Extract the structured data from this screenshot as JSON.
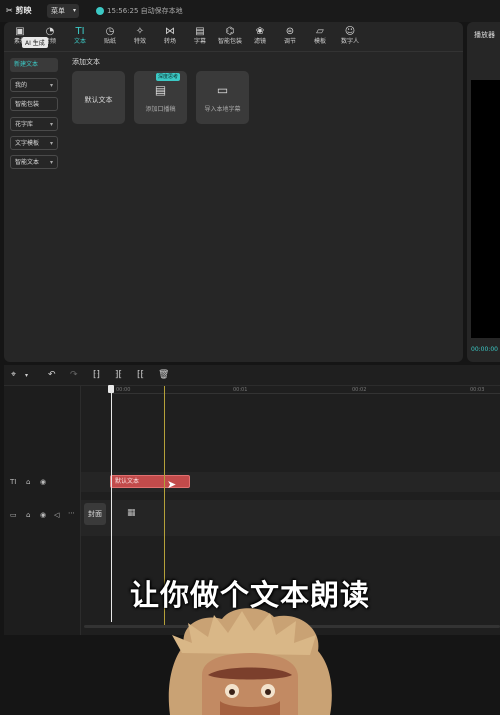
{
  "app": {
    "name": "剪映",
    "menu": "菜单",
    "save_status": "15:56:25 自动保存本地"
  },
  "toolbar": {
    "items": [
      {
        "label": "素材",
        "icon": "media-icon"
      },
      {
        "label": "音频",
        "icon": "audio-icon"
      },
      {
        "label": "文本",
        "icon": "text-icon",
        "active": true
      },
      {
        "label": "贴纸",
        "icon": "sticker-icon"
      },
      {
        "label": "特效",
        "icon": "effects-icon"
      },
      {
        "label": "转场",
        "icon": "transition-icon"
      },
      {
        "label": "字幕",
        "icon": "subtitle-icon"
      },
      {
        "label": "智能包装",
        "icon": "smart-package-icon"
      },
      {
        "label": "滤镜",
        "icon": "filter-icon"
      },
      {
        "label": "调节",
        "icon": "adjust-icon"
      },
      {
        "label": "模板",
        "icon": "template-icon"
      },
      {
        "label": "数字人",
        "icon": "digital-human-icon"
      }
    ],
    "tooltip": "AI 生成"
  },
  "sidebar": {
    "items": [
      {
        "label": "新建文本",
        "selected": true
      },
      {
        "label": "我的",
        "chevron": true
      },
      {
        "label": "智能包装"
      },
      {
        "label": "花字库",
        "chevron": true
      },
      {
        "label": "文字模板",
        "chevron": true
      },
      {
        "label": "智能文本",
        "chevron": true
      }
    ]
  },
  "content": {
    "section_title": "添加文本",
    "cards": [
      {
        "label": "默认文本"
      },
      {
        "label": "添加口播稿",
        "badge": "深度思考"
      },
      {
        "label": "导入本地字幕"
      }
    ]
  },
  "player": {
    "title": "播放器",
    "time": "00:00:00"
  },
  "timeline": {
    "ruler": [
      "00:00",
      "00:01",
      "00:02",
      "00:03"
    ],
    "text_clip": "默认文本",
    "cover_label": "封面"
  },
  "overlay": {
    "subtitle": "让你做个文本朗读"
  },
  "colors": {
    "accent": "#3cc9c5",
    "clip": "#c24b4b",
    "panel": "#262626"
  }
}
